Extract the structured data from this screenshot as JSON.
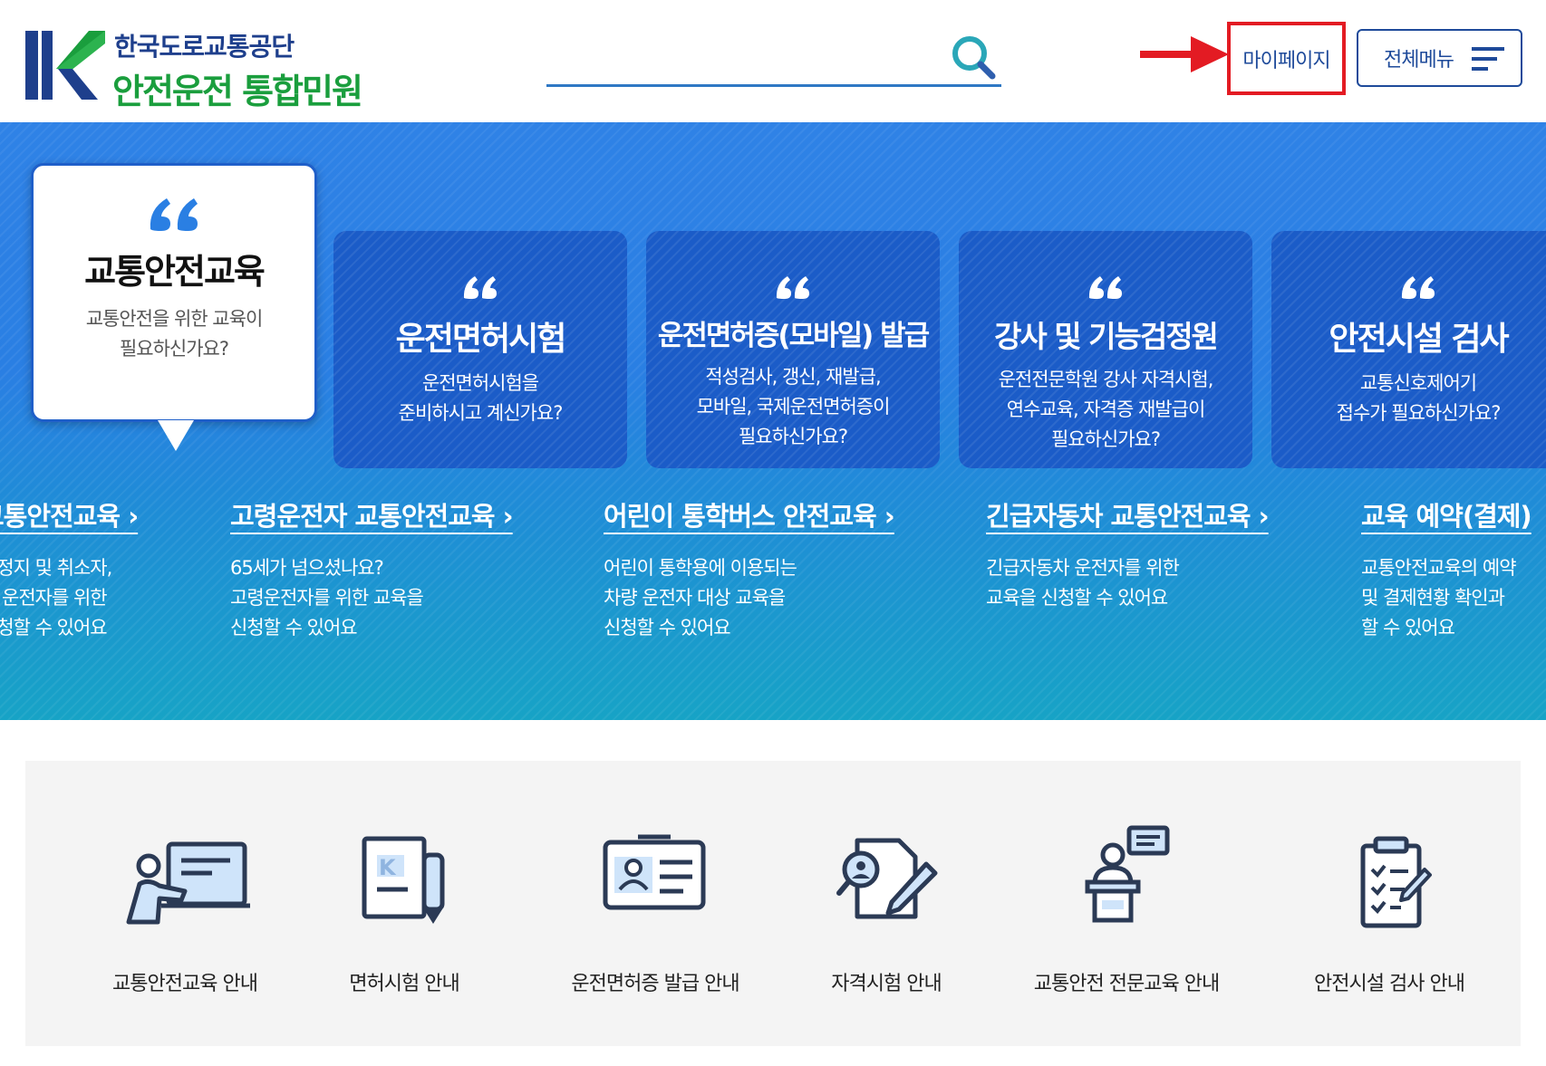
{
  "header": {
    "logo": {
      "org": "한국도로교통공단",
      "title": "안전운전 통합민원"
    },
    "search": {
      "value": "",
      "placeholder": ""
    },
    "mypage_label": "마이페이지",
    "allmenu_label": "전체메뉴"
  },
  "colors": {
    "brand_blue": "#1e4a9a",
    "brand_green": "#1a9e3d",
    "highlight_red": "#e31b23",
    "banner_blue": "#2a7fe3",
    "card_blue": "#1b5cc8"
  },
  "categories": [
    {
      "title": "교통안전교육",
      "desc": [
        "교통안전을 위한 교육이",
        "필요하신가요?"
      ],
      "active": true
    },
    {
      "title": "운전면허시험",
      "desc": [
        "운전면허시험을",
        "준비하시고 계신가요?"
      ],
      "active": false
    },
    {
      "title": "운전면허증(모바일) 발급",
      "desc": [
        "적성검사, 갱신, 재발급,",
        "모바일, 국제운전면허증이",
        "필요하신가요?"
      ],
      "active": false
    },
    {
      "title": "강사 및 기능검정원",
      "desc": [
        "운전전문학원 강사 자격시험,",
        "연수교육, 자격증 재발급이",
        "필요하신가요?"
      ],
      "active": false
    },
    {
      "title": "안전시설 검사",
      "desc": [
        "교통신호제어기",
        "접수가 필요하신가요?"
      ],
      "active": false
    }
  ],
  "sub_items": [
    {
      "title": "교통안전교육",
      "desc": [
        "허정지 및 취소자,",
        "유 운전자를 위한",
        "신청할 수 있어요"
      ]
    },
    {
      "title": "고령운전자 교통안전교육",
      "desc": [
        "65세가 넘으셨나요?",
        "고령운전자를 위한 교육을",
        "신청할 수 있어요"
      ]
    },
    {
      "title": "어린이 통학버스 안전교육",
      "desc": [
        "어린이 통학용에 이용되는",
        "차량 운전자 대상 교육을",
        "신청할 수 있어요"
      ]
    },
    {
      "title": "긴급자동차 교통안전교육",
      "desc": [
        "긴급자동차 운전자를 위한",
        "교육을 신청할 수 있어요"
      ]
    },
    {
      "title": "교육 예약(결제)",
      "desc": [
        "교통안전교육의 예약",
        "및 결제현황 확인과",
        "할 수 있어요"
      ]
    }
  ],
  "quick_menu": [
    {
      "label": "교통안전교육 안내",
      "icon": "teacher-board-icon"
    },
    {
      "label": "면허시험 안내",
      "icon": "license-pen-icon"
    },
    {
      "label": "운전면허증 발급 안내",
      "icon": "id-card-icon"
    },
    {
      "label": "자격시험 안내",
      "icon": "document-search-pen-icon"
    },
    {
      "label": "교통안전 전문교육 안내",
      "icon": "lecturer-podium-icon"
    },
    {
      "label": "안전시설 검사 안내",
      "icon": "clipboard-checklist-icon"
    }
  ]
}
